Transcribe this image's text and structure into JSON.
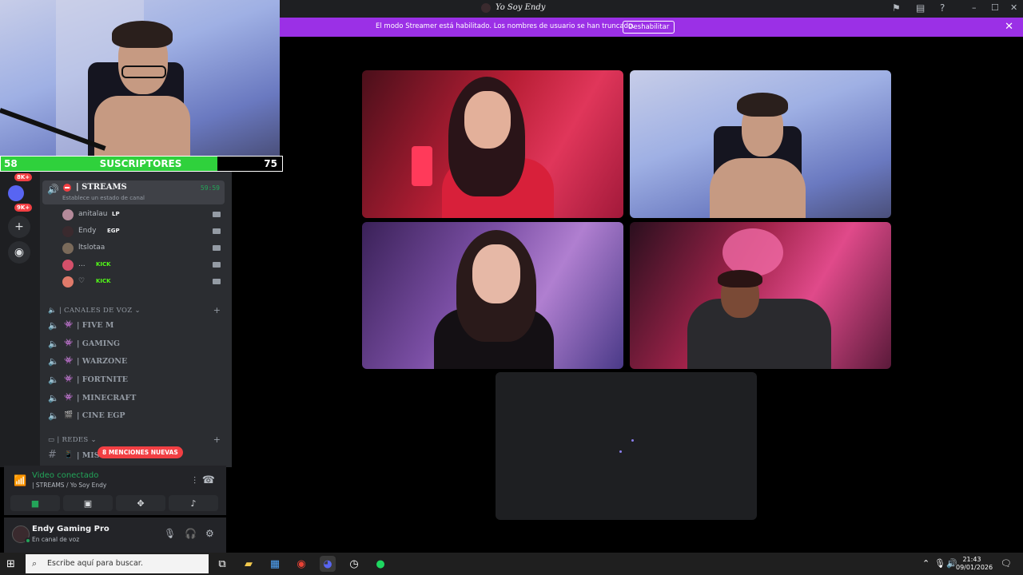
{
  "overlay": {
    "subs_current": "58",
    "subs_label": "SUSCRIPTORES",
    "subs_goal": "75",
    "subs_progress": 0.77
  },
  "titlebar": {
    "title": "Yo Soy Endy"
  },
  "streamer_banner": {
    "text": "El modo Streamer está habilitado. Los nombres de usuario se han truncado.",
    "button": "Deshabilitar"
  },
  "server_rail": {
    "badges": [
      "8K+",
      "9K+"
    ]
  },
  "stream_channel": {
    "name": "| STREAMS",
    "status": "Establece un estado de canal",
    "timer": "59:59"
  },
  "members": [
    {
      "name": "anitalau",
      "tag": "LP"
    },
    {
      "name": "Endy",
      "tag": "EGP"
    },
    {
      "name": "ltslotaa",
      "tag": ""
    },
    {
      "name": "...",
      "tag": "KICK"
    },
    {
      "name": "♡",
      "tag": "KICK"
    }
  ],
  "voice_category": "| CANALES DE VOZ",
  "voice_channels": [
    "| FIVE M",
    "|  GAMING",
    "| WARZONE",
    "| FORTNITE",
    "| MINECRAFT",
    "| CINE EGP"
  ],
  "redes_category": "| REDES",
  "redes_channel": "| MIS",
  "mentions_badge": "8 MENCIONES NUEVAS",
  "voice_status": {
    "title": "Video conectado",
    "channel": "| STREAMS / Yo Soy Endy"
  },
  "user": {
    "name": "Endy Gaming Pro",
    "status": "En canal de voz"
  },
  "taskbar": {
    "search_placeholder": "Escribe aquí para buscar.",
    "time": "21:43",
    "date": "09/01/2026"
  }
}
